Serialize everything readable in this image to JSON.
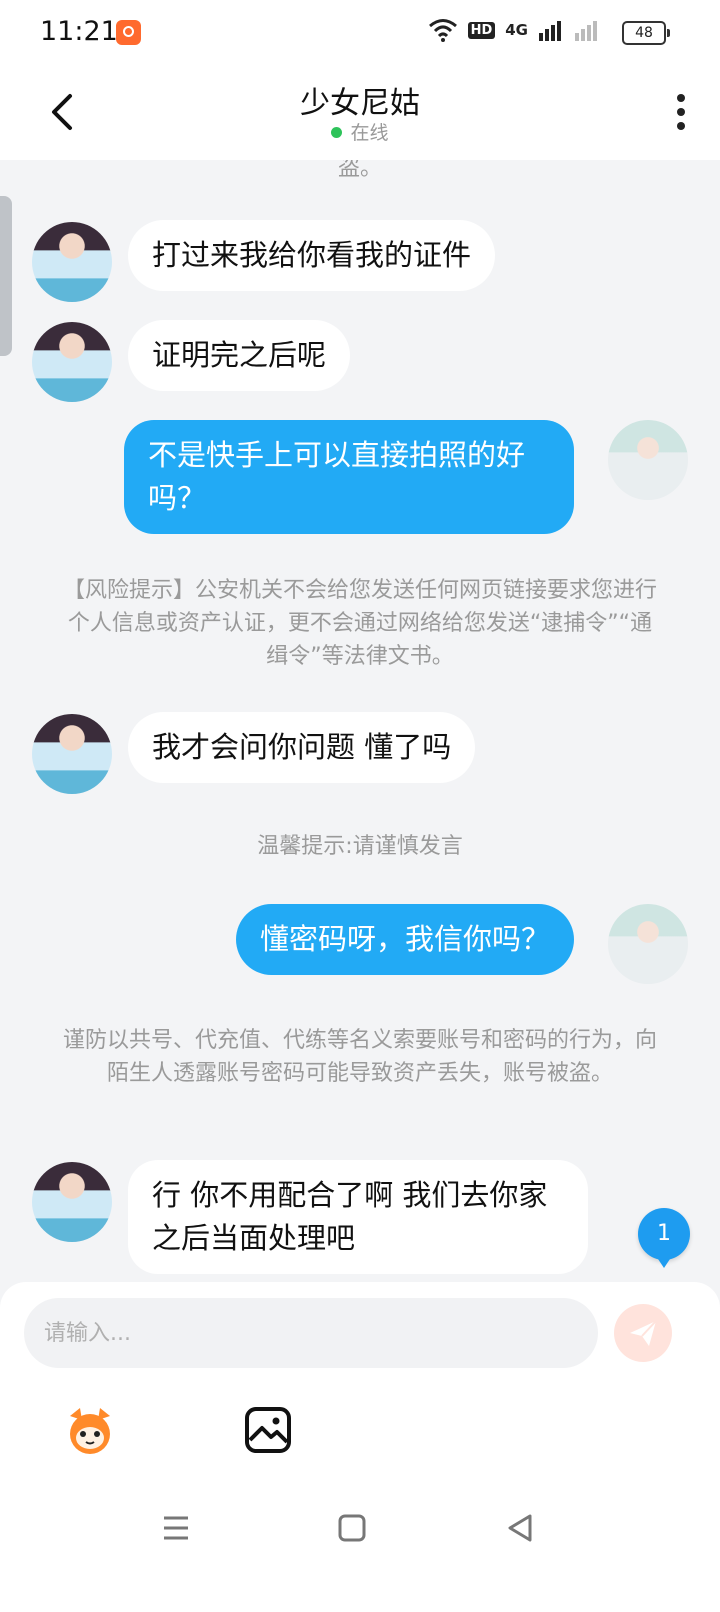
{
  "status_bar": {
    "time": "11:21",
    "hd_label": "HD",
    "network_label": "4G",
    "battery": "48"
  },
  "header": {
    "title": "少女尼姑",
    "status": "在线"
  },
  "chat": {
    "top_partial_text": "盗。",
    "messages": [
      {
        "side": "in",
        "text": "打过来我给你看我的证件"
      },
      {
        "side": "in",
        "text": "证明完之后呢"
      },
      {
        "side": "out",
        "text": "不是快手上可以直接拍照的好吗？"
      },
      {
        "side": "system",
        "text": "【风险提示】公安机关不会给您发送任何网页链接要求您进行个人信息或资产认证，更不会通过网络给您发送“逮捕令”“通缉令”等法律文书。"
      },
      {
        "side": "in",
        "text": "我才会问你问题 懂了吗"
      },
      {
        "side": "system",
        "text": "温馨提示:请谨慎发言"
      },
      {
        "side": "out",
        "text": "懂密码呀，我信你吗？"
      },
      {
        "side": "system",
        "text": "谨防以共号、代充值、代练等名义索要账号和密码的行为，向陌生人透露账号密码可能导致资产丢失，账号被盗。"
      },
      {
        "side": "in",
        "text": "行 你不用配合了啊 我们去你家之后当面处理吧"
      }
    ],
    "unread_badge": "1"
  },
  "input": {
    "placeholder": "请输入..."
  },
  "icons": {
    "back": "chevron-left-icon",
    "more": "more-vertical-icon",
    "send": "send-icon",
    "emoji": "mascot-emoji-icon",
    "image": "image-icon",
    "accent_color": "#22aaf5",
    "send_color": "#ffe3dc"
  }
}
